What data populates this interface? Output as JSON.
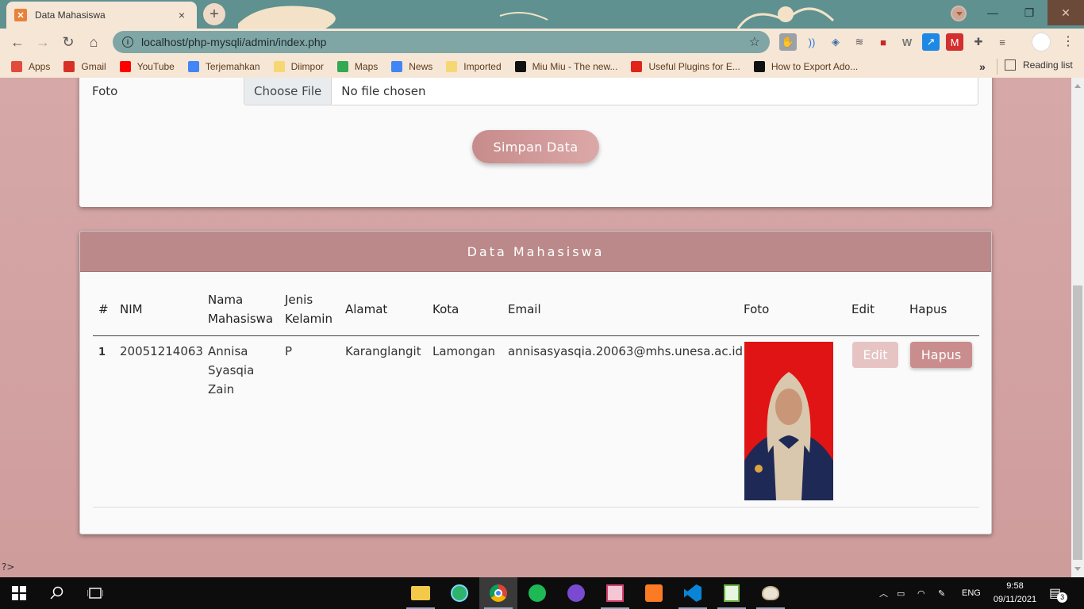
{
  "browser": {
    "tab_title": "Data Mahasiswa",
    "tab_close": "×",
    "new_tab": "+",
    "url": "localhost/php-mysqli/admin/index.php",
    "window_controls": {
      "minimize": "—",
      "maximize": "❐",
      "close": "✕"
    }
  },
  "bookmarks": [
    {
      "label": "Apps",
      "icon": "apps-grid-icon",
      "color": "#e24b3b"
    },
    {
      "label": "Gmail",
      "icon": "gmail-icon",
      "color": "#d93025"
    },
    {
      "label": "YouTube",
      "icon": "youtube-icon",
      "color": "#ff0000"
    },
    {
      "label": "Terjemahkan",
      "icon": "translate-icon",
      "color": "#4285f4"
    },
    {
      "label": "Diimpor",
      "icon": "folder-icon",
      "color": "#f7d774"
    },
    {
      "label": "Maps",
      "icon": "maps-icon",
      "color": "#34a853"
    },
    {
      "label": "News",
      "icon": "news-icon",
      "color": "#4285f4"
    },
    {
      "label": "Imported",
      "icon": "folder-icon",
      "color": "#f7d774"
    },
    {
      "label": "Miu Miu - The new...",
      "icon": "miumiu-icon",
      "color": "#111111"
    },
    {
      "label": "Useful Plugins for E...",
      "icon": "adobe-icon",
      "color": "#e1251b"
    },
    {
      "label": "How to Export Ado...",
      "icon": "medium-icon",
      "color": "#111111"
    }
  ],
  "bookmarks_more": "»",
  "reading_list": "Reading list",
  "form": {
    "foto_label": "Foto",
    "choose_file": "Choose File",
    "no_file": "No file chosen",
    "submit": "Simpan Data"
  },
  "table": {
    "title": "Data Mahasiswa",
    "headers": {
      "no": "#",
      "nim": "NIM",
      "nama_1": "Nama",
      "nama_2": "Mahasiswa",
      "jk_1": "Jenis",
      "jk_2": "Kelamin",
      "alamat": "Alamat",
      "kota": "Kota",
      "email": "Email",
      "foto": "Foto",
      "edit": "Edit",
      "hapus": "Hapus"
    },
    "rows": [
      {
        "no": "1",
        "nim": "20051214063",
        "nama_1": "Annisa",
        "nama_2": "Syasqia",
        "nama_3": "Zain",
        "jk": "P",
        "alamat": "Karanglangit",
        "kota": "Lamongan",
        "email": "annisasyasqia.20063@mhs.unesa.ac.id",
        "edit_label": "Edit",
        "hapus_label": "Hapus"
      }
    ]
  },
  "php_tail": "?>",
  "taskbar": {
    "lang": "ENG",
    "time": "9:58",
    "date": "09/11/2021",
    "notifications": "3"
  },
  "colors": {
    "accent": "#bb8989",
    "page_bg": "#d3a4a4",
    "photo_bg": "#e01414"
  }
}
